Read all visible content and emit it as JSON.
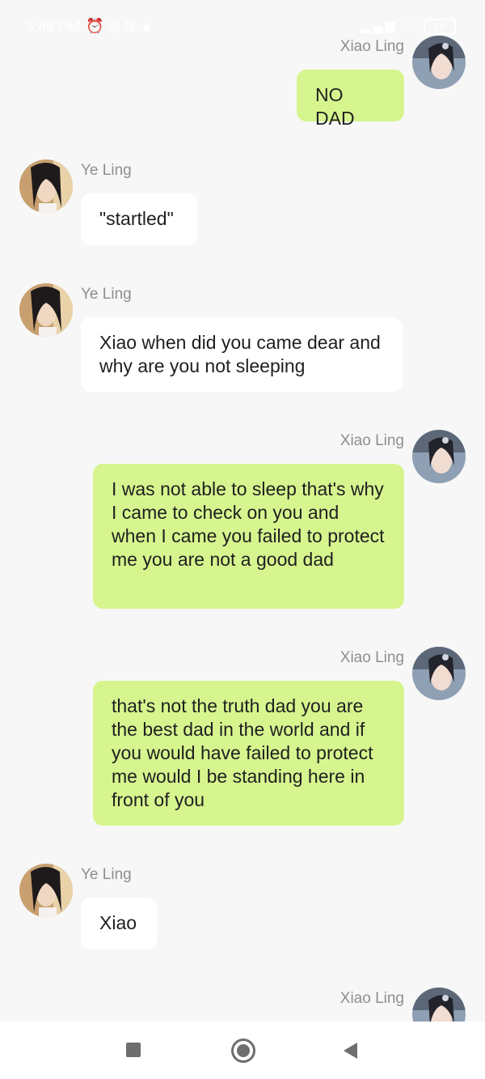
{
  "status_bar": {
    "time": "3:49 PM",
    "left_icons": [
      "alarm-icon",
      "whatsapp-icon",
      "settings-icon",
      "warning-icon"
    ],
    "right_icons": [
      "signal-icon",
      "wifi-icon",
      "battery-icon"
    ],
    "battery_level": "39"
  },
  "messages": [
    {
      "side": "right",
      "sender": "Xiao Ling",
      "text": "NO DAD"
    },
    {
      "side": "left",
      "sender": "Ye Ling",
      "text": "\"startled\""
    },
    {
      "side": "left",
      "sender": "Ye Ling",
      "text": "Xiao when did you came dear and why are you not sleeping"
    },
    {
      "side": "right",
      "sender": "Xiao Ling",
      "text": "I was not able to sleep that's why I came to check on you and when I came you failed to protect me you are not a good dad"
    },
    {
      "side": "right",
      "sender": "Xiao Ling",
      "text": "that's not the truth dad you are the best dad in the world and if you would have failed to protect me would I be standing here in front of you"
    },
    {
      "side": "left",
      "sender": "Ye Ling",
      "text": "Xiao"
    },
    {
      "side": "right",
      "sender": "Xiao Ling",
      "text": ""
    }
  ],
  "nav_bar": {
    "buttons": [
      "recent-apps-button",
      "home-button",
      "back-button"
    ]
  },
  "colors": {
    "background": "#f7f7f7",
    "user_bubble": "#d6f58f",
    "other_bubble": "#ffffff",
    "sender_name": "#8e8e8e"
  }
}
